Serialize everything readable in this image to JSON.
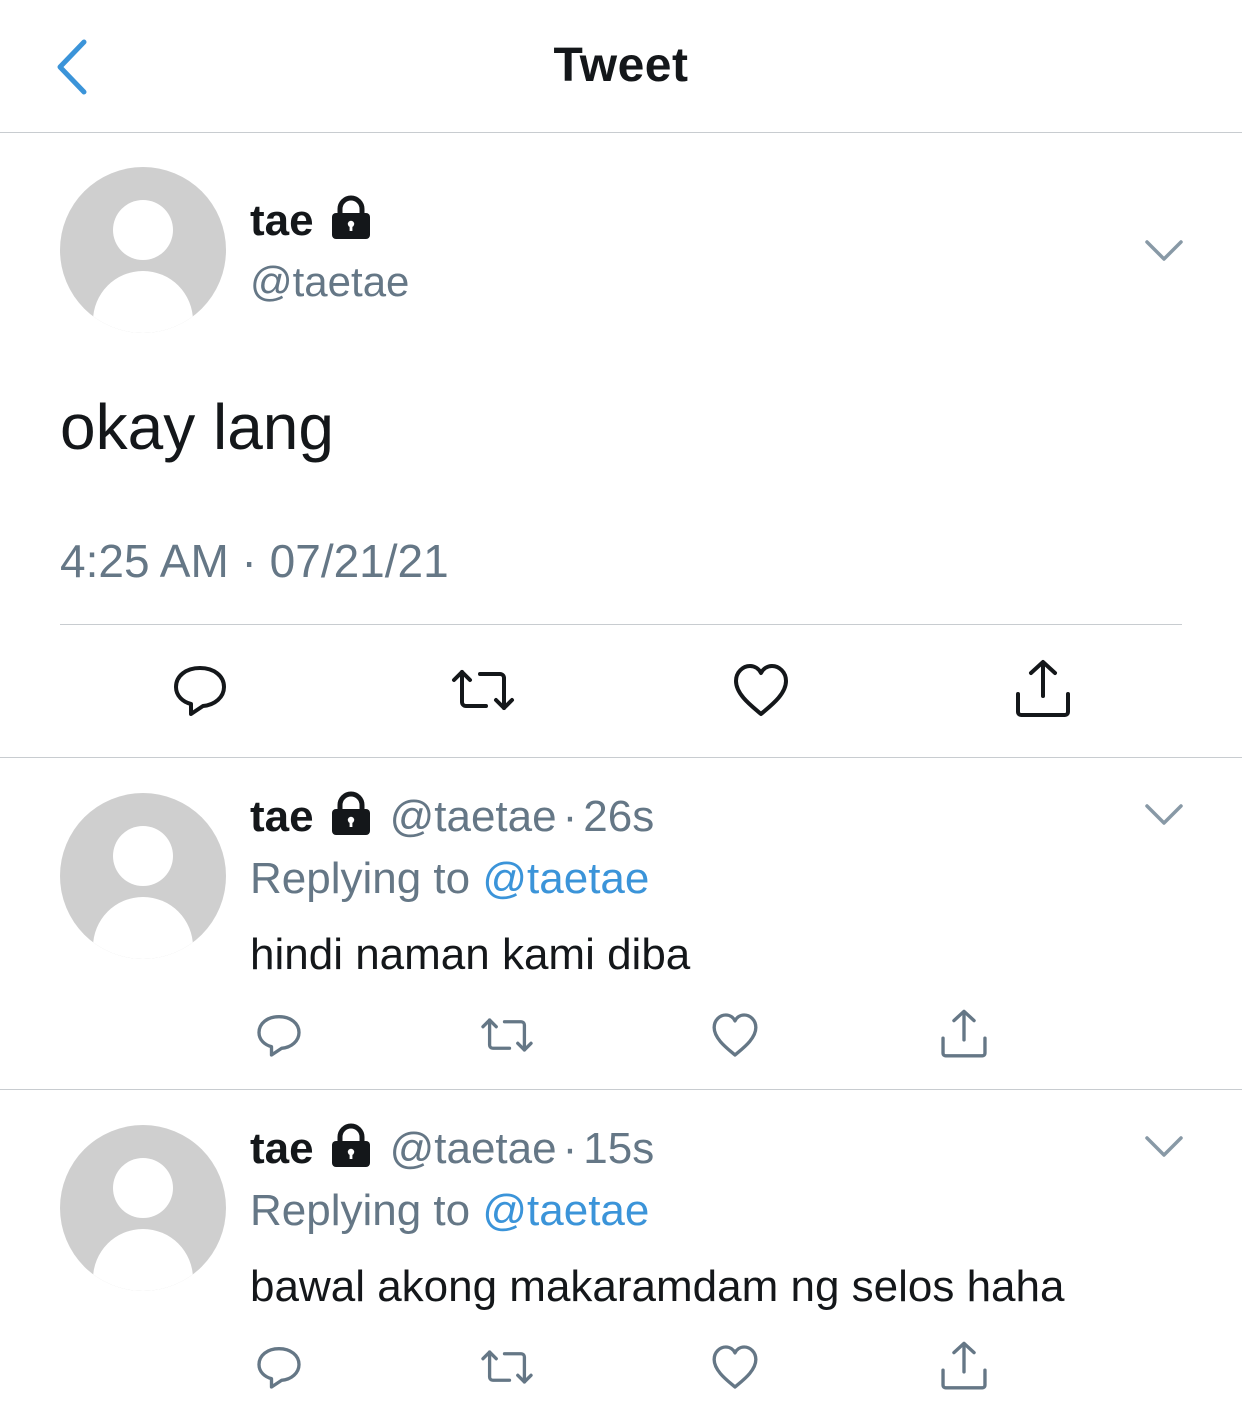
{
  "header": {
    "title": "Tweet"
  },
  "main_tweet": {
    "display_name": "tae",
    "handle": "@taetae",
    "text": "okay lang",
    "meta": "4:25 AM · 07/21/21"
  },
  "replies": [
    {
      "display_name": "tae",
      "handle": "@taetae",
      "dot": "·",
      "time": "26s",
      "replying_prefix": "Replying to ",
      "replying_to": "@taetae",
      "text": "hindi naman kami diba"
    },
    {
      "display_name": "tae",
      "handle": "@taetae",
      "dot": "·",
      "time": "15s",
      "replying_prefix": "Replying to ",
      "replying_to": "@taetae",
      "text": "bawal akong makaramdam ng selos haha"
    }
  ],
  "icons": {
    "back": "chevron-left-icon",
    "lock": "lock-icon",
    "caret": "chevron-down-icon",
    "reply": "reply-icon",
    "retweet": "retweet-icon",
    "like": "heart-icon",
    "share": "share-icon"
  },
  "colors": {
    "accent": "#3b94d9",
    "secondary_text": "#657786",
    "icon_gray": "#657786",
    "divider": "#c8ccd0",
    "avatar": "#cfcfcf"
  }
}
